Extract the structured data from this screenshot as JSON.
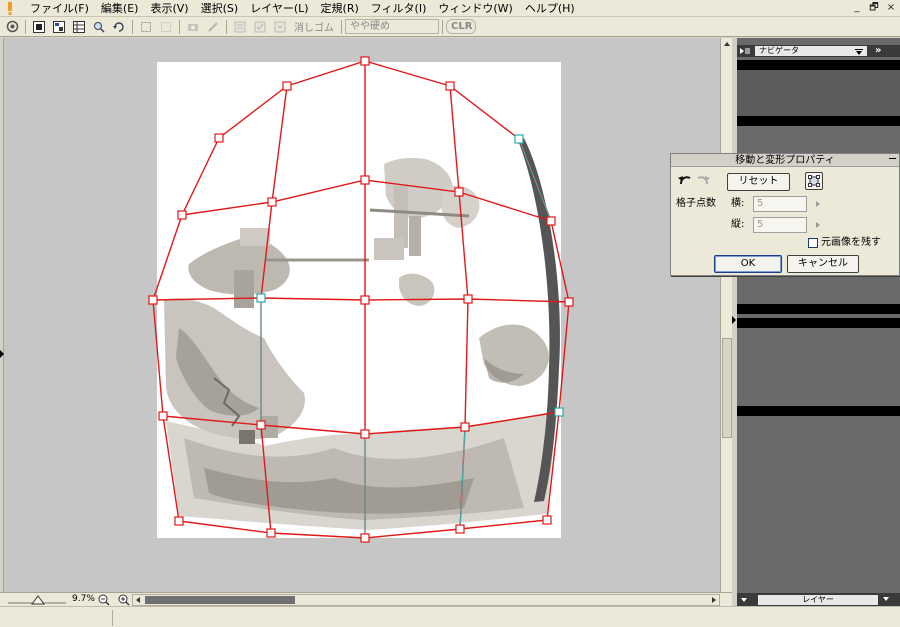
{
  "menubar": {
    "items": [
      "ファイル(F)",
      "編集(E)",
      "表示(V)",
      "選択(S)",
      "レイヤー(L)",
      "定規(R)",
      "フィルタ(I)",
      "ウィンドウ(W)",
      "ヘルプ(H)"
    ],
    "window_controls": [
      "_",
      "🗗",
      "×"
    ]
  },
  "toolbar": {
    "eraser_label": "消しゴム",
    "hardness_label": "やや硬め",
    "clear_label": "CLR"
  },
  "canvas": {
    "zoom_label": "9.7%"
  },
  "dock": {
    "navigator_tab": "ナビゲータ",
    "layer_tab": "レイヤー"
  },
  "dialog": {
    "title": "移動と変形プロパティ",
    "reset_button": "リセット",
    "grid_points_label": "格子点数",
    "horizontal_label": "横:",
    "horizontal_value": "5",
    "vertical_label": "縦:",
    "vertical_value": "5",
    "keep_original_label": "元画像を残す",
    "keep_original_checked": false,
    "ok_button": "OK",
    "cancel_button": "キャンセル"
  },
  "colors": {
    "mesh_line": "#e11818",
    "canvas_bg": "#c6c6c6",
    "paper": "#ffffff",
    "dock_bg": "#6a6a6a"
  }
}
